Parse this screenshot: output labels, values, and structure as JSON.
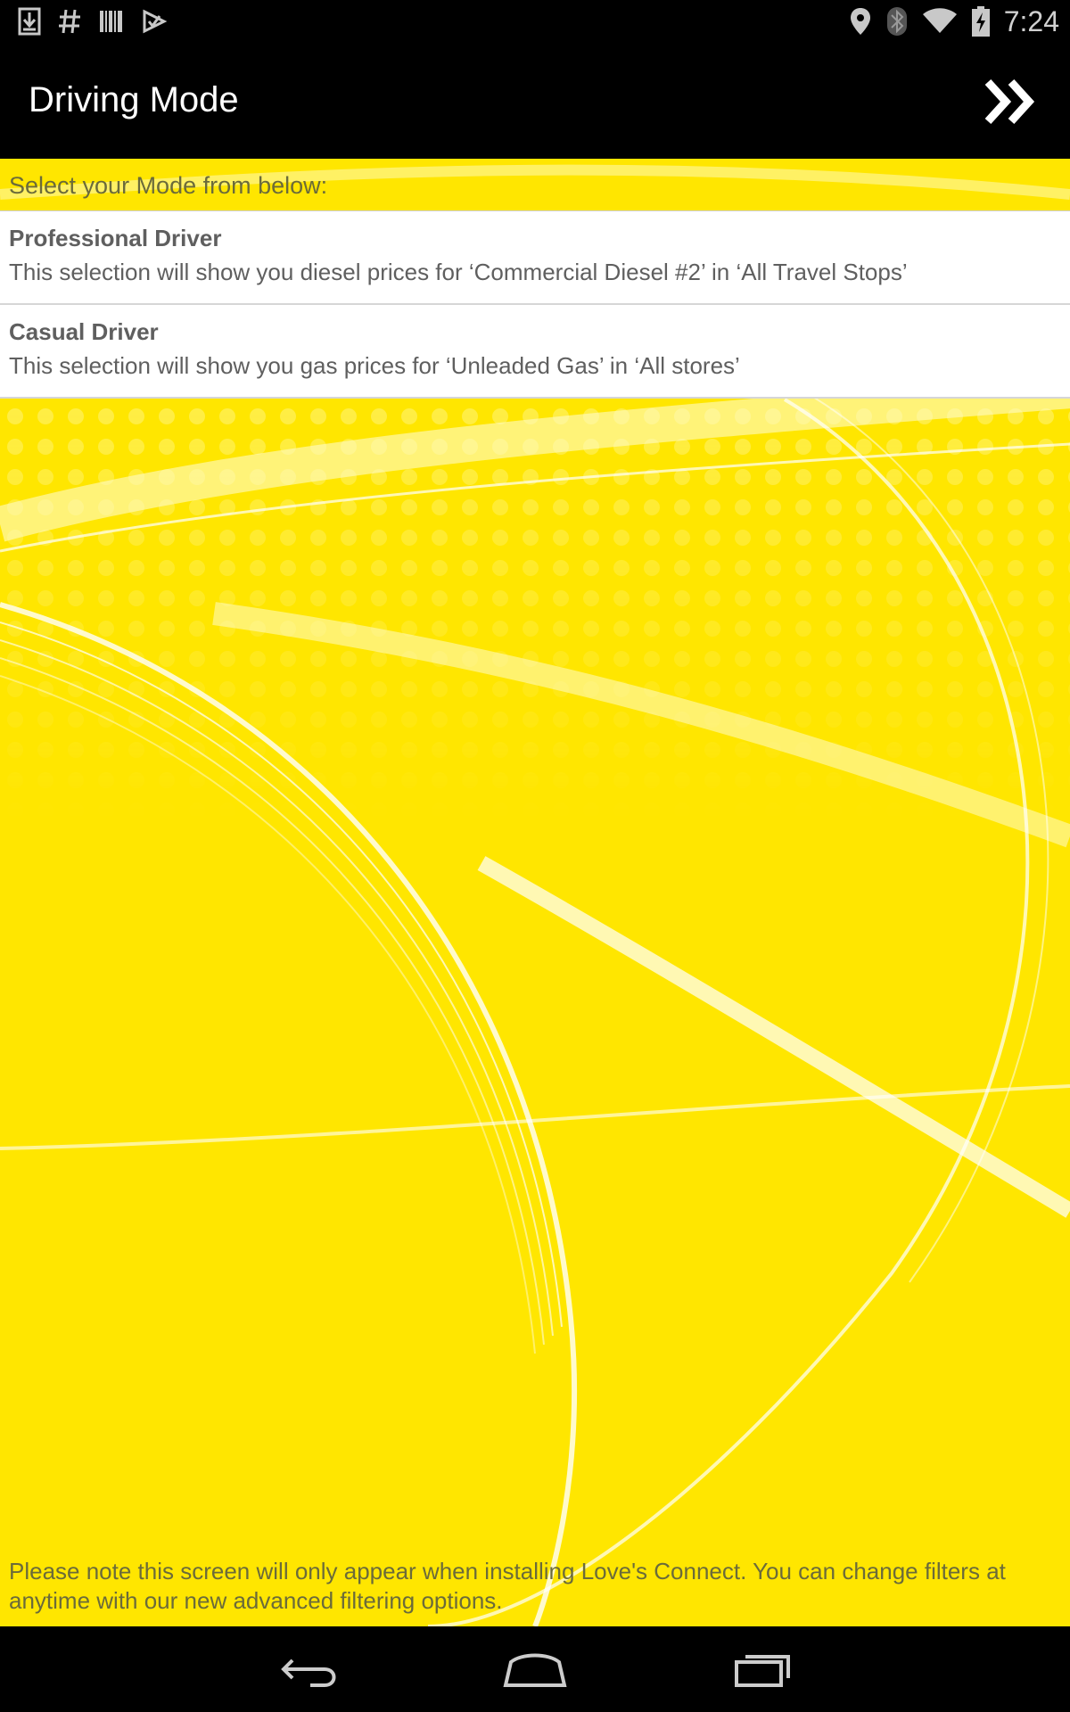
{
  "status_bar": {
    "time": "7:24",
    "left_icons": [
      "download-icon",
      "hash-icon",
      "barcode-icon",
      "play-store-icon"
    ],
    "right_icons": [
      "location-icon",
      "bluetooth-icon",
      "wifi-icon",
      "battery-charging-icon"
    ]
  },
  "action_bar": {
    "title": "Driving Mode",
    "next_icon": "double-chevron-right-icon"
  },
  "content": {
    "header": "Select your Mode from below:",
    "options": [
      {
        "title": "Professional Driver",
        "description": "This selection will show you diesel prices for ‘Commercial Diesel #2’ in ‘All Travel Stops’"
      },
      {
        "title": "Casual Driver",
        "description": "This selection will show you gas prices for ‘Unleaded Gas’ in ‘All stores’"
      }
    ],
    "note": "Please note this screen will only appear when installing Love's Connect. You can change filters at anytime with our new advanced filtering options."
  },
  "nav_bar": {
    "buttons": [
      "back-icon",
      "home-icon",
      "recents-icon"
    ]
  },
  "colors": {
    "background_yellow": "#ffe600",
    "bar_black": "#000000",
    "option_text": "#5f5f5f"
  }
}
